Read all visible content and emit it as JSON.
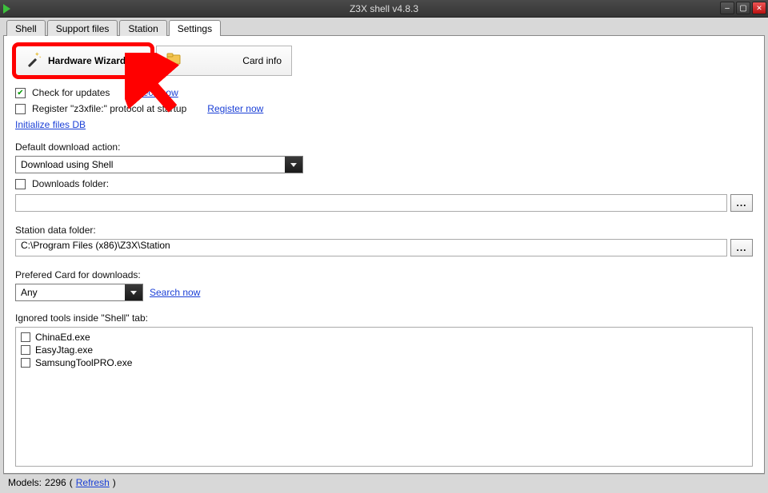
{
  "window": {
    "title": "Z3X shell v4.8.3"
  },
  "tabs": [
    {
      "label": "Shell"
    },
    {
      "label": "Support files"
    },
    {
      "label": "Station"
    },
    {
      "label": "Settings"
    }
  ],
  "top": {
    "hardware_wizard": "Hardware Wizard",
    "card_info": "Card info"
  },
  "opts": {
    "check_updates_label": "Check for updates",
    "check_now": "Check now",
    "register_protocol_label": "Register \"z3xfile:\" protocol at startup",
    "register_now": "Register now",
    "initialize_db": "Initialize files DB"
  },
  "download": {
    "section_label": "Default download action:",
    "selected": "Download using Shell",
    "downloads_folder_label": "Downloads folder:",
    "downloads_folder_value": ""
  },
  "station": {
    "section_label": "Station data folder:",
    "value": "C:\\Program Files (x86)\\Z3X\\Station"
  },
  "card": {
    "section_label": "Prefered Card for downloads:",
    "selected": "Any",
    "search_now": "Search now"
  },
  "ignored": {
    "section_label": "Ignored tools inside \"Shell\" tab:",
    "items": [
      "ChinaEd.exe",
      "EasyJtag.exe",
      "SamsungToolPRO.exe"
    ]
  },
  "status": {
    "prefix": "Models: ",
    "count": "2296",
    "refresh": "Refresh"
  },
  "annotation": {
    "type": "arrow",
    "target": "hardware-wizard-button",
    "color": "#f00"
  }
}
